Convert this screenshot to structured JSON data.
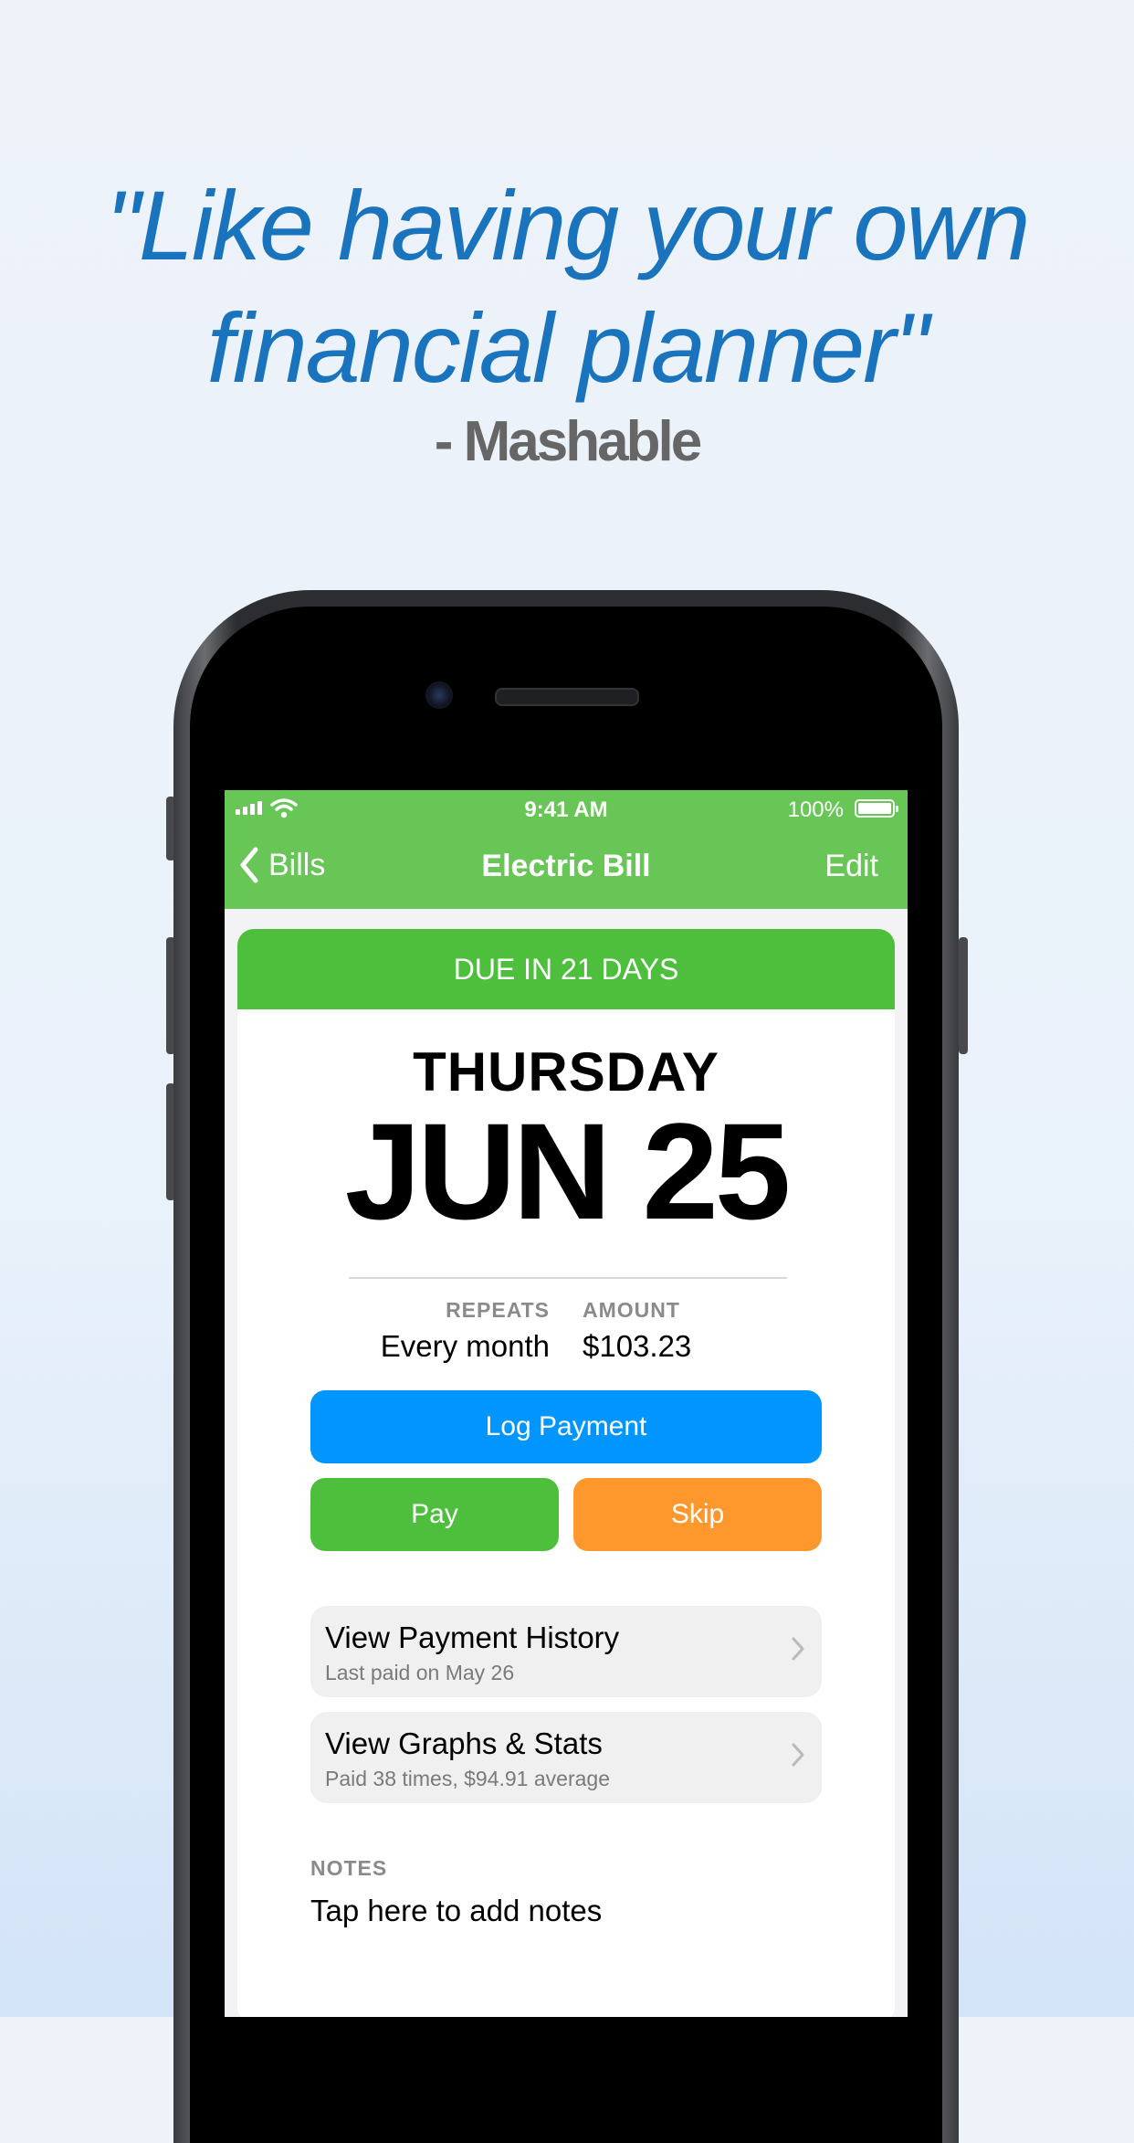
{
  "headline": {
    "line1": "\"Like having your own",
    "line2": "financial planner\"",
    "attribution": "- Mashable"
  },
  "status_bar": {
    "time": "9:41 AM",
    "battery": "100%"
  },
  "nav": {
    "back_label": "Bills",
    "title": "Electric Bill",
    "edit_label": "Edit"
  },
  "bill": {
    "due_banner": "DUE IN 21 DAYS",
    "weekday": "THURSDAY",
    "date": "JUN 25",
    "repeats_label": "REPEATS",
    "repeats_value": "Every month",
    "amount_label": "AMOUNT",
    "amount_value": "$103.23"
  },
  "actions": {
    "log_payment": "Log Payment",
    "pay": "Pay",
    "skip": "Skip"
  },
  "rows": [
    {
      "title": "View Payment History",
      "subtitle": "Last paid on May 26"
    },
    {
      "title": "View Graphs & Stats",
      "subtitle": "Paid 38 times, $94.91 average"
    }
  ],
  "notes": {
    "label": "NOTES",
    "placeholder": "Tap here to add notes"
  },
  "colors": {
    "headline": "#1a74bd",
    "nav_green": "#68c656",
    "banner_green": "#4ebf3d",
    "log_blue": "#0196ff",
    "skip_orange": "#ff982c"
  }
}
